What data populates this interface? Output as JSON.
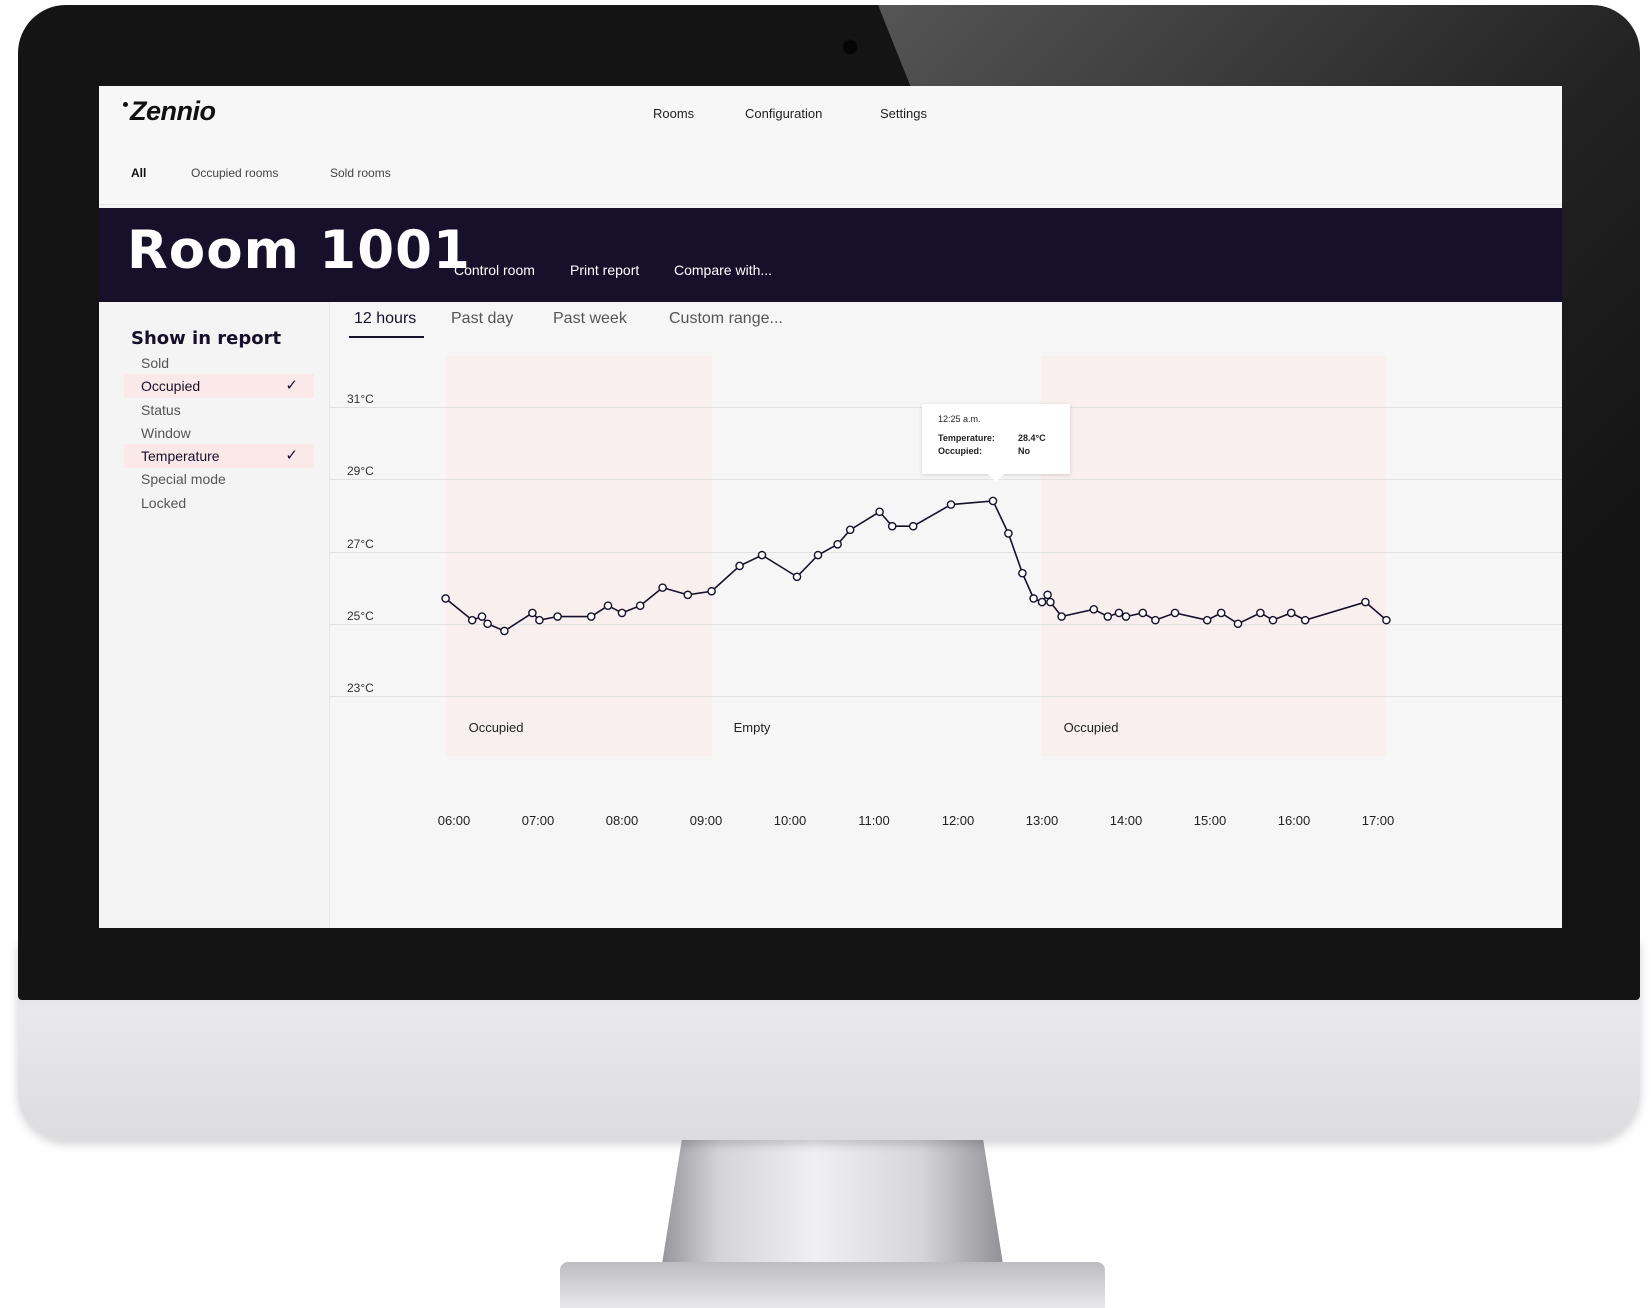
{
  "app": {
    "logo": "Zennio"
  },
  "nav": {
    "main": [
      "Rooms",
      "Configuration",
      "Settings"
    ],
    "sub": [
      "All",
      "Occupied rooms",
      "Sold rooms"
    ]
  },
  "room": {
    "title": "Room 1001",
    "actions": [
      "Control room",
      "Print report",
      "Compare with..."
    ]
  },
  "sidebar": {
    "title": "Show in report",
    "items": [
      {
        "label": "Sold",
        "checked": false
      },
      {
        "label": "Occupied",
        "checked": true
      },
      {
        "label": "Status",
        "checked": false
      },
      {
        "label": "Window",
        "checked": false
      },
      {
        "label": "Temperature",
        "checked": true
      },
      {
        "label": "Special mode",
        "checked": false
      },
      {
        "label": "Locked",
        "checked": false
      }
    ],
    "check_glyph": "✓"
  },
  "range_tabs": [
    "12 hours",
    "Past day",
    "Past week",
    "Custom range..."
  ],
  "range_selected": "12 hours",
  "tooltip": {
    "time": "12:25 a.m.",
    "temperature_label": "Temperature:",
    "temperature_value": "28.4°C",
    "occupied_label": "Occupied:",
    "occupied_value": "No"
  },
  "colors": {
    "header_bg": "#16102b",
    "line": "#16102b",
    "occupied_band": "#fce4e2",
    "selected_item": "#fbe9e9"
  },
  "chart_data": {
    "type": "line",
    "y_tick_labels": [
      "31°C",
      "29°C",
      "27°C",
      "25°C",
      "23°C"
    ],
    "x_tick_labels": [
      "06:00",
      "07:00",
      "08:00",
      "09:00",
      "10:00",
      "11:00",
      "12:00",
      "13:00",
      "14:00",
      "15:00",
      "16:00",
      "17:00"
    ],
    "ylim": [
      23,
      31
    ],
    "xlim": [
      "06:00",
      "17:00"
    ],
    "grid": true,
    "series": [
      {
        "points": [
          {
            "x": "05:54",
            "y": 25.7
          },
          {
            "x": "06:13",
            "y": 25.1
          },
          {
            "x": "06:20",
            "y": 25.2
          },
          {
            "x": "06:24",
            "y": 25.0
          },
          {
            "x": "06:36",
            "y": 24.8
          },
          {
            "x": "06:56",
            "y": 25.3
          },
          {
            "x": "07:01",
            "y": 25.1
          },
          {
            "x": "07:14",
            "y": 25.2
          },
          {
            "x": "07:38",
            "y": 25.2
          },
          {
            "x": "07:50",
            "y": 25.5
          },
          {
            "x": "08:00",
            "y": 25.3
          },
          {
            "x": "08:13",
            "y": 25.5
          },
          {
            "x": "08:29",
            "y": 26.0
          },
          {
            "x": "08:47",
            "y": 25.8
          },
          {
            "x": "09:04",
            "y": 25.9
          },
          {
            "x": "09:24",
            "y": 26.6
          },
          {
            "x": "09:40",
            "y": 26.9
          },
          {
            "x": "10:05",
            "y": 26.3
          },
          {
            "x": "10:20",
            "y": 26.9
          },
          {
            "x": "10:34",
            "y": 27.2
          },
          {
            "x": "10:43",
            "y": 27.6
          },
          {
            "x": "11:04",
            "y": 28.1
          },
          {
            "x": "11:13",
            "y": 27.7
          },
          {
            "x": "11:28",
            "y": 27.7
          },
          {
            "x": "11:55",
            "y": 28.3
          },
          {
            "x": "12:25",
            "y": 28.4
          },
          {
            "x": "12:36",
            "y": 27.5
          },
          {
            "x": "12:46",
            "y": 26.4
          },
          {
            "x": "12:54",
            "y": 25.7
          },
          {
            "x": "13:00",
            "y": 25.6
          },
          {
            "x": "13:04",
            "y": 25.8
          },
          {
            "x": "13:06",
            "y": 25.6
          },
          {
            "x": "13:14",
            "y": 25.2
          },
          {
            "x": "13:37",
            "y": 25.4
          },
          {
            "x": "13:47",
            "y": 25.2
          },
          {
            "x": "13:55",
            "y": 25.3
          },
          {
            "x": "14:00",
            "y": 25.2
          },
          {
            "x": "14:12",
            "y": 25.3
          },
          {
            "x": "14:21",
            "y": 25.1
          },
          {
            "x": "14:35",
            "y": 25.3
          },
          {
            "x": "14:58",
            "y": 25.1
          },
          {
            "x": "15:08",
            "y": 25.3
          },
          {
            "x": "15:20",
            "y": 25.0
          },
          {
            "x": "15:36",
            "y": 25.3
          },
          {
            "x": "15:45",
            "y": 25.1
          },
          {
            "x": "15:58",
            "y": 25.3
          },
          {
            "x": "16:08",
            "y": 25.1
          },
          {
            "x": "16:51",
            "y": 25.6
          },
          {
            "x": "17:06",
            "y": 25.1
          }
        ]
      }
    ],
    "states": [
      {
        "label": "Occupied",
        "from": "05:54",
        "to": "09:04"
      },
      {
        "label": "Empty",
        "from": "09:04",
        "to": "12:59"
      },
      {
        "label": "Occupied",
        "from": "12:59",
        "to": "17:06"
      }
    ]
  }
}
